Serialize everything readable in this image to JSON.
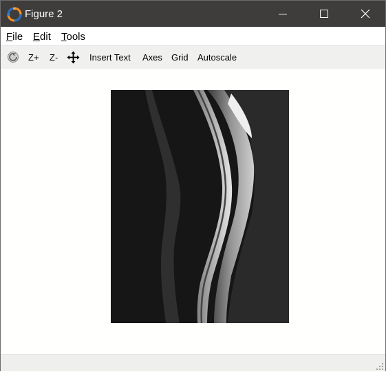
{
  "window": {
    "title": "Figure 2",
    "controls": {
      "minimize": "minimize-icon",
      "maximize": "maximize-icon",
      "close": "close-icon"
    }
  },
  "menu": {
    "file": {
      "accel": "F",
      "rest": "ile"
    },
    "edit": {
      "accel": "E",
      "rest": "dit"
    },
    "tools": {
      "accel": "T",
      "rest": "ools"
    }
  },
  "toolbar": {
    "rotate_icon": "rotate-icon",
    "zoom_in": "Z+",
    "zoom_out": "Z-",
    "pan_icon": "pan-move-icon",
    "insert_text": "Insert Text",
    "axes": "Axes",
    "grid": "Grid",
    "autoscale": "Autoscale"
  },
  "figure": {
    "content": "grayscale sagittal spine MRI image",
    "background_color": "#161616"
  },
  "colors": {
    "titlebar": "#3f3d3b",
    "toolbar": "#f0f0ee",
    "canvas": "#fffffd"
  }
}
